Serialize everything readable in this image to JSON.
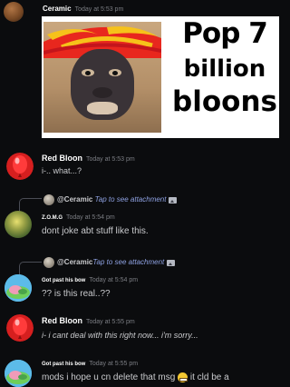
{
  "messages": [
    {
      "author": "Ceramic",
      "timestamp": "Today at 5:53 pm",
      "meme": {
        "line1": "Pop 7",
        "line2": "billion",
        "line3": "bloons"
      }
    },
    {
      "author": "Red Bloon",
      "timestamp": "Today at 5:53 pm",
      "text": "i-.. what...?"
    },
    {
      "reply_to": "@Ceramic",
      "reply_text": "Tap to see attachment",
      "author": "Z.O.M.G",
      "timestamp": "Today at 5:54 pm",
      "text": "dont joke abt stuff like this."
    },
    {
      "reply_to": "@Ceramic",
      "reply_text": "Tap to see attachment",
      "author": "Got past his bow",
      "timestamp": "Today at 5:54 pm",
      "text": "?? is this real..??"
    },
    {
      "author": "Red Bloon",
      "timestamp": "Today at 5:55 pm",
      "text": "i- i cant deal with this right now... i'm sorry..."
    },
    {
      "author": "Got past his bow",
      "timestamp": "Today at 5:55 pm",
      "text_before": "mods i hope u cn delete that msg",
      "text_after": "it cld be a"
    }
  ],
  "colors": {
    "background": "#0b0c0e",
    "red_bloon": "#d61f1f",
    "link": "#8ea1e1"
  },
  "icons": [
    "image-icon",
    "grimace-emoji-icon"
  ]
}
